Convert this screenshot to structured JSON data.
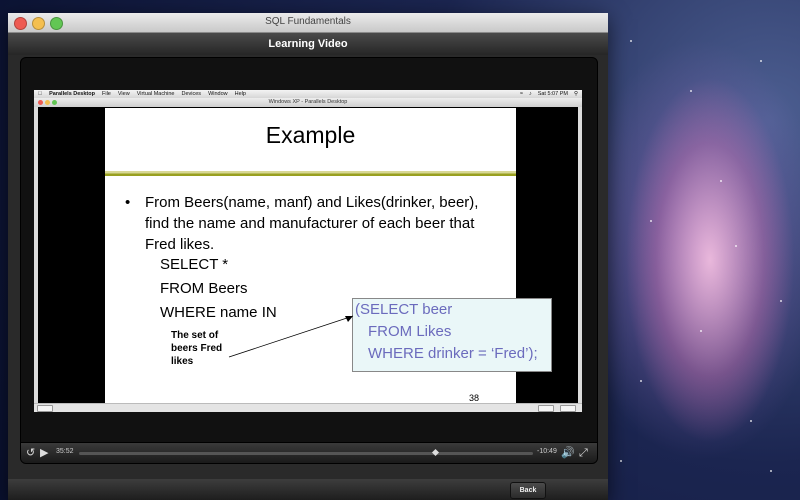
{
  "window": {
    "title": "SQL Fundamentals"
  },
  "toolbar": {
    "title": "Learning Video"
  },
  "vm": {
    "menubar": {
      "app": "Parallels Desktop",
      "items": [
        "File",
        "View",
        "Virtual Machine",
        "Devices",
        "Window",
        "Help"
      ],
      "clock": "Sat 5:07 PM"
    },
    "window_title": "Windows XP - Parallels Desktop"
  },
  "slide": {
    "title": "Example",
    "bullet": "From Beers(name, manf) and Likes(drinker, beer), find the name and manufacturer of each beer that Fred likes.",
    "sql_select": "SELECT *",
    "sql_from": "FROM Beers",
    "sql_where": "WHERE name IN",
    "subquery": [
      "(SELECT beer",
      "FROM Likes",
      "WHERE drinker = ‘Fred’);"
    ],
    "annotation": "The set of beers Fred likes",
    "page_number": "38"
  },
  "player": {
    "elapsed": "35:52",
    "remaining": "-10:49",
    "progress": 0.78
  },
  "footer": {
    "back_label": "Back"
  }
}
